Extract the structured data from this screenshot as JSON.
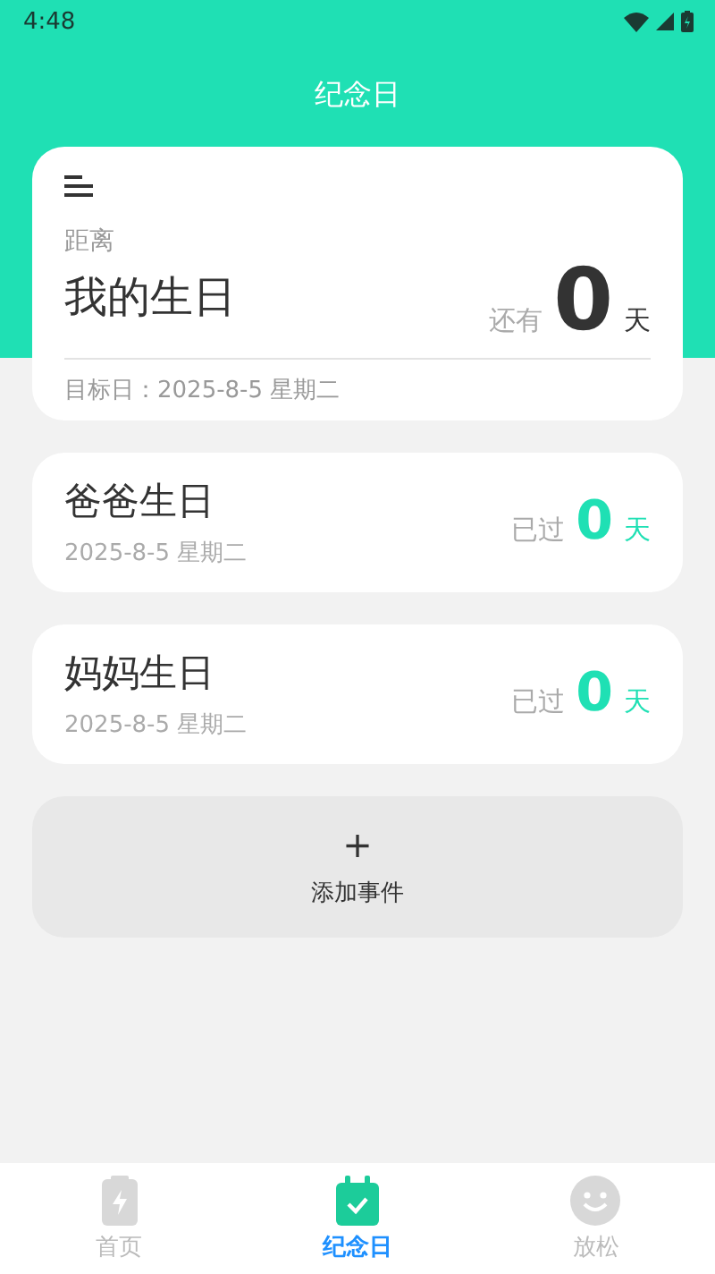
{
  "status_bar": {
    "time": "4:48"
  },
  "title": "纪念日",
  "featured": {
    "prefix": "距离",
    "name": "我的生日",
    "lead": "还有",
    "count": "0",
    "unit": "天",
    "footer": "目标日：2025-8-5 星期二"
  },
  "events": [
    {
      "name": "爸爸生日",
      "date": "2025-8-5 星期二",
      "lead": "已过",
      "count": "0",
      "unit": "天"
    },
    {
      "name": "妈妈生日",
      "date": "2025-8-5 星期二",
      "lead": "已过",
      "count": "0",
      "unit": "天"
    }
  ],
  "add_button": {
    "icon": "+",
    "label": "添加事件"
  },
  "tabs": [
    {
      "kind": "battery",
      "label": "首页",
      "selected": false
    },
    {
      "kind": "calendar",
      "label": "纪念日",
      "selected": true
    },
    {
      "kind": "smile",
      "label": "放松",
      "selected": false
    }
  ]
}
